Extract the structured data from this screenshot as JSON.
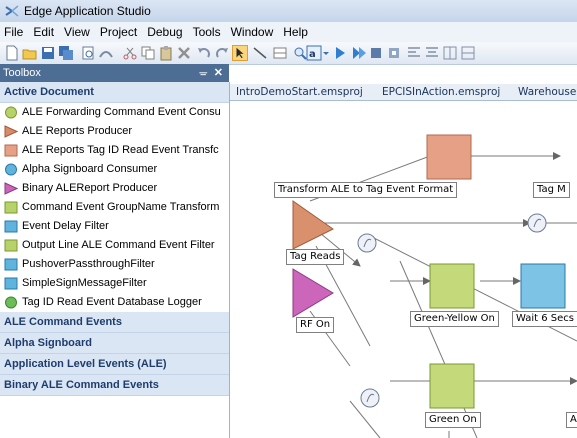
{
  "window": {
    "title": "Edge Application Studio"
  },
  "menu": [
    "File",
    "Edit",
    "View",
    "Project",
    "Debug",
    "Tools",
    "Window",
    "Help"
  ],
  "toolbox": {
    "title": "Toolbox",
    "pin_glyph": "ᚚ",
    "close_glyph": "✕",
    "active_category": "Active Document",
    "items": [
      {
        "label": "ALE Forwarding Command Event Consu",
        "icon": "green-circle-icon",
        "color": "#b8d26a"
      },
      {
        "label": "ALE Reports Producer",
        "icon": "orange-triangle-icon",
        "color": "#d98a68"
      },
      {
        "label": "ALE Reports Tag ID Read Event Transfc",
        "icon": "salmon-square-icon",
        "color": "#e6a085"
      },
      {
        "label": "Alpha Signboard Consumer",
        "icon": "blue-circle-icon",
        "color": "#5fb3dc"
      },
      {
        "label": "Binary ALEReport Producer",
        "icon": "pink-triangle-icon",
        "color": "#cc66bb"
      },
      {
        "label": "Command Event GroupName Transform",
        "icon": "green-square-icon",
        "color": "#b8d26a"
      },
      {
        "label": "Event Delay Filter",
        "icon": "blue-square-icon",
        "color": "#5fb3dc"
      },
      {
        "label": "Output Line ALE Command Event Filter",
        "icon": "green-square-icon",
        "color": "#b8d26a"
      },
      {
        "label": "PushoverPassthroughFilter",
        "icon": "blue-square-icon",
        "color": "#5fb3dc"
      },
      {
        "label": "SimpleSignMessageFilter",
        "icon": "blue-square-icon",
        "color": "#5fb3dc"
      },
      {
        "label": "Tag ID Read Event Database Logger",
        "icon": "green-circle-icon",
        "color": "#6dbb5a"
      }
    ],
    "categories": [
      "ALE Command Events",
      "Alpha Signboard",
      "Application Level Events (ALE)",
      "Binary ALE Command Events"
    ]
  },
  "tabs": [
    "IntroDemoStart.emsproj",
    "EPCISInAction.emsproj",
    "Warehouse.ems"
  ],
  "diagram": {
    "nodes": {
      "transform": "Transform ALE to Tag Event Format",
      "tag_partial": "Tag M",
      "tag_reads": "Tag Reads",
      "rf_on": "RF On",
      "green_yellow": "Green-Yellow On",
      "wait": "Wait 6 Secs",
      "green_on": "Green On",
      "a_partial": "A"
    }
  }
}
